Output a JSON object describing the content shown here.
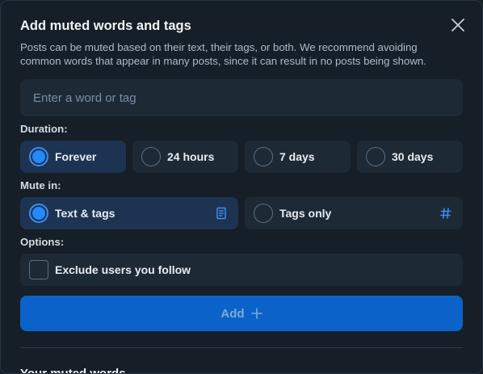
{
  "dialog": {
    "title": "Add muted words and tags",
    "description": "Posts can be muted based on their text, their tags, or both. We recommend avoiding common words that appear in many posts, since it can result in no posts being shown.",
    "close_icon": "close-icon"
  },
  "input": {
    "value": "",
    "placeholder": "Enter a word or tag"
  },
  "duration": {
    "label": "Duration:",
    "options": [
      {
        "label": "Forever",
        "selected": true
      },
      {
        "label": "24 hours",
        "selected": false
      },
      {
        "label": "7 days",
        "selected": false
      },
      {
        "label": "30 days",
        "selected": false
      }
    ]
  },
  "mute_in": {
    "label": "Mute in:",
    "options": [
      {
        "label": "Text & tags",
        "selected": true,
        "icon": "document-icon"
      },
      {
        "label": "Tags only",
        "selected": false,
        "icon": "hashtag-icon"
      }
    ]
  },
  "options": {
    "label": "Options:",
    "exclude_following": {
      "label": "Exclude users you follow",
      "checked": false
    }
  },
  "add_button": {
    "label": "Add",
    "icon": "plus-icon"
  },
  "muted_words": {
    "title": "Your muted words"
  },
  "colors": {
    "background": "#161e27",
    "surface": "#1e2936",
    "selected_surface": "#1c3452",
    "accent": "#208bfe",
    "button": "#0b63c9"
  }
}
